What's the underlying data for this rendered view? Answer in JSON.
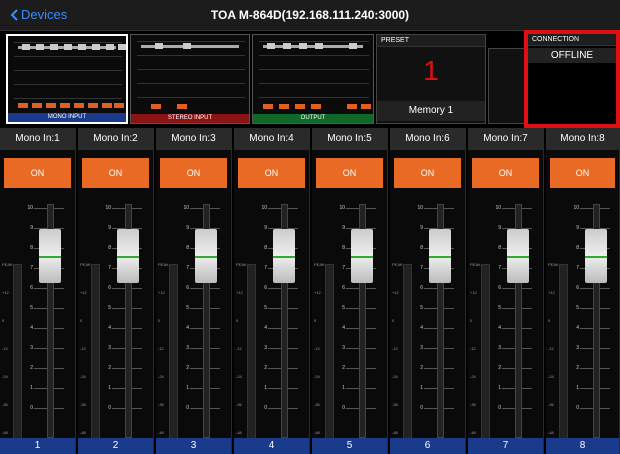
{
  "nav": {
    "back_label": "Devices",
    "title": "TOA M-864D(192.168.111.240:3000)"
  },
  "overview": {
    "mono_label": "MONO INPUT",
    "stereo_label": "STEREO INPUT",
    "output_label": "OUTPUT"
  },
  "preset": {
    "header": "PRESET",
    "number": "1",
    "name": "Memory 1"
  },
  "connection": {
    "header": "CONNECTION",
    "status": "OFFLINE"
  },
  "channels": [
    {
      "name": "Mono In:1",
      "on_label": "ON",
      "number": "1"
    },
    {
      "name": "Mono In:2",
      "on_label": "ON",
      "number": "2"
    },
    {
      "name": "Mono In:3",
      "on_label": "ON",
      "number": "3"
    },
    {
      "name": "Mono In:4",
      "on_label": "ON",
      "number": "4"
    },
    {
      "name": "Mono In:5",
      "on_label": "ON",
      "number": "5"
    },
    {
      "name": "Mono In:6",
      "on_label": "ON",
      "number": "6"
    },
    {
      "name": "Mono In:7",
      "on_label": "ON",
      "number": "7"
    },
    {
      "name": "Mono In:8",
      "on_label": "ON",
      "number": "8"
    }
  ],
  "fader_scale": [
    "10",
    "9",
    "8",
    "7",
    "6",
    "5",
    "4",
    "3",
    "2",
    "1",
    "0"
  ],
  "meter_scale": [
    "PEAK",
    "+12",
    "0",
    "-12",
    "-24",
    "-36",
    "-48"
  ],
  "colors": {
    "on": "#e86a24",
    "preset_num": "#e01010",
    "highlight": "#e01010",
    "channel_bar": "#1a3a8c"
  }
}
